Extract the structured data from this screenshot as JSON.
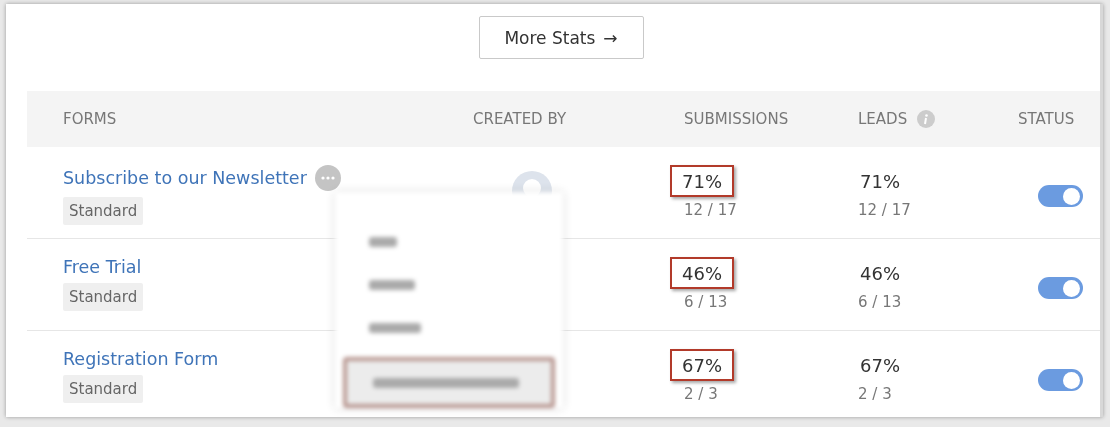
{
  "more_stats_button": {
    "label": "More Stats",
    "arrow": "→"
  },
  "table": {
    "columns": [
      {
        "label": "FORMS",
        "info": false
      },
      {
        "label": "CREATED BY",
        "info": false
      },
      {
        "label": "SUBMISSIONS",
        "info": false
      },
      {
        "label": "LEADS",
        "info": true
      },
      {
        "label": "STATUS",
        "info": false
      }
    ],
    "rows": [
      {
        "name": "Subscribe to our Newsletter",
        "more_menu": true,
        "tag": "Standard",
        "submissions": {
          "percent": "71%",
          "count": "12 / 17",
          "highlighted": true
        },
        "leads": {
          "percent": "71%",
          "count": "12 / 17"
        },
        "status_on": true
      },
      {
        "name": "Free Trial",
        "more_menu": false,
        "tag": "Standard",
        "submissions": {
          "percent": "46%",
          "count": "6 / 13",
          "highlighted": true
        },
        "leads": {
          "percent": "46%",
          "count": "6 / 13"
        },
        "status_on": true
      },
      {
        "name": "Registration Form",
        "more_menu": false,
        "tag": "Standard",
        "submissions": {
          "percent": "67%",
          "count": "2 / 3",
          "highlighted": true
        },
        "leads": {
          "percent": "67%",
          "count": "2 / 3"
        },
        "status_on": true
      }
    ]
  },
  "context_menu": {
    "items": [
      {
        "highlighted": false
      },
      {
        "highlighted": false
      },
      {
        "highlighted": false
      },
      {
        "highlighted": true
      }
    ]
  }
}
